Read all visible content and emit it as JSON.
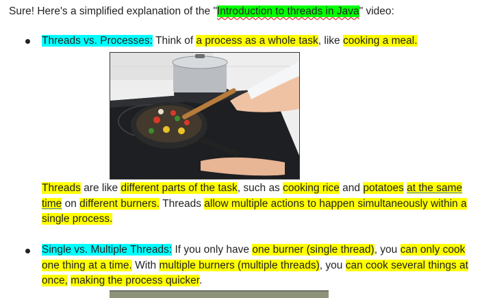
{
  "intro": {
    "before": "Sure! Here's a simplified explanation of the \"",
    "video_title": "Introduction to threads in Java",
    "after": "\" video:"
  },
  "item1": {
    "heading": "Threads vs. Processes:",
    "t1": "Think of",
    "h1": "a process as a whole task",
    "t2": ", like",
    "h2": "cooking a meal.",
    "p1": "Threads",
    "p2": "are like",
    "p3": "different parts of the task",
    "p4": ", such as",
    "p5": "cooking rice",
    "p6": "and",
    "p7": "potatoes",
    "p8": "at the same time",
    "p9": "on",
    "p10": "different burners.",
    "p11": "Threads",
    "p12": "allow multiple actions to happen simultaneously within a single process."
  },
  "item2": {
    "heading": "Single vs. Multiple Threads:",
    "t1": "If you only have",
    "h1": "one burner (single thread)",
    "t2": ", you",
    "h2": "can only cook one thing at a time.",
    "t3": "With",
    "h3": "multiple burners (multiple threads)",
    "t4": ", you",
    "h4": "can cook several things at once,",
    "h5": "making the process quicker",
    "t5": "."
  }
}
